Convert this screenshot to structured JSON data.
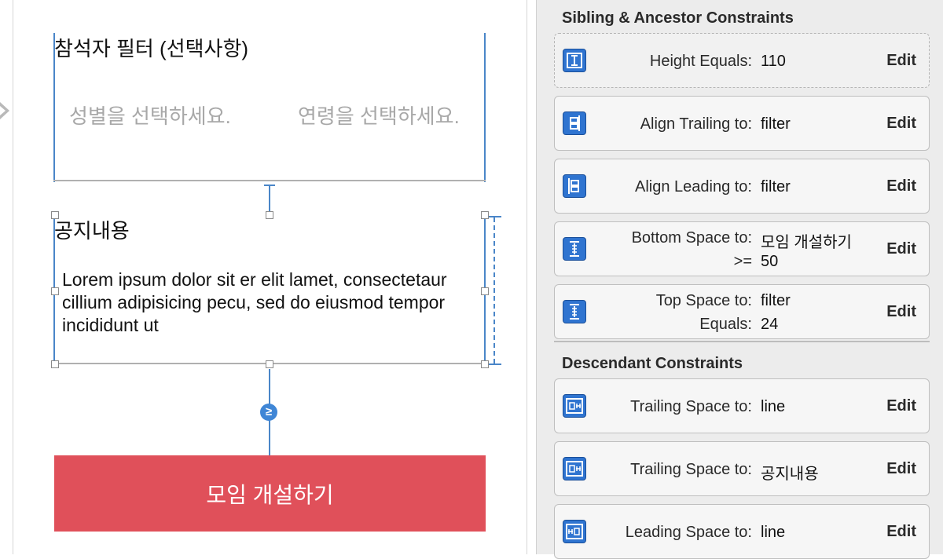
{
  "canvas": {
    "filter_title": "참석자 필터 (선택사항)",
    "gender_placeholder": "성별을 선택하세요.",
    "age_placeholder": "연령을 선택하세요.",
    "notice_title": "공지내용",
    "notice_body": "Lorem ipsum dolor sit er elit lamet, consectetaur cillium adipisicing pecu, sed do eiusmod tempor incididunt ut",
    "gte_symbol": "≥",
    "create_button": "모임 개설하기"
  },
  "inspector": {
    "sibling_title": "Sibling & Ancestor Constraints",
    "descendant_title": "Descendant Constraints",
    "edit_label": "Edit",
    "sibling_rows": [
      {
        "icon": "height-constraint-icon",
        "label": "Height Equals:",
        "value": "110"
      },
      {
        "icon": "align-trailing-icon",
        "label": "Align Trailing to:",
        "value": "filter"
      },
      {
        "icon": "align-leading-icon",
        "label": "Align Leading to:",
        "value": "filter"
      },
      {
        "icon": "vertical-space-icon",
        "label": "Bottom Space to:",
        "value": "모임 개설하기",
        "label2": ">=",
        "value2": "50"
      },
      {
        "icon": "vertical-space-icon",
        "label": "Top Space to:",
        "value": "filter",
        "label2": "Equals:",
        "value2": "24"
      }
    ],
    "descendant_rows": [
      {
        "icon": "trailing-space-icon",
        "label": "Trailing Space to:",
        "value": "line"
      },
      {
        "icon": "trailing-space-icon",
        "label": "Trailing Space to:",
        "value": "공지내용"
      },
      {
        "icon": "leading-space-icon",
        "label": "Leading Space to:",
        "value": "line"
      }
    ]
  }
}
